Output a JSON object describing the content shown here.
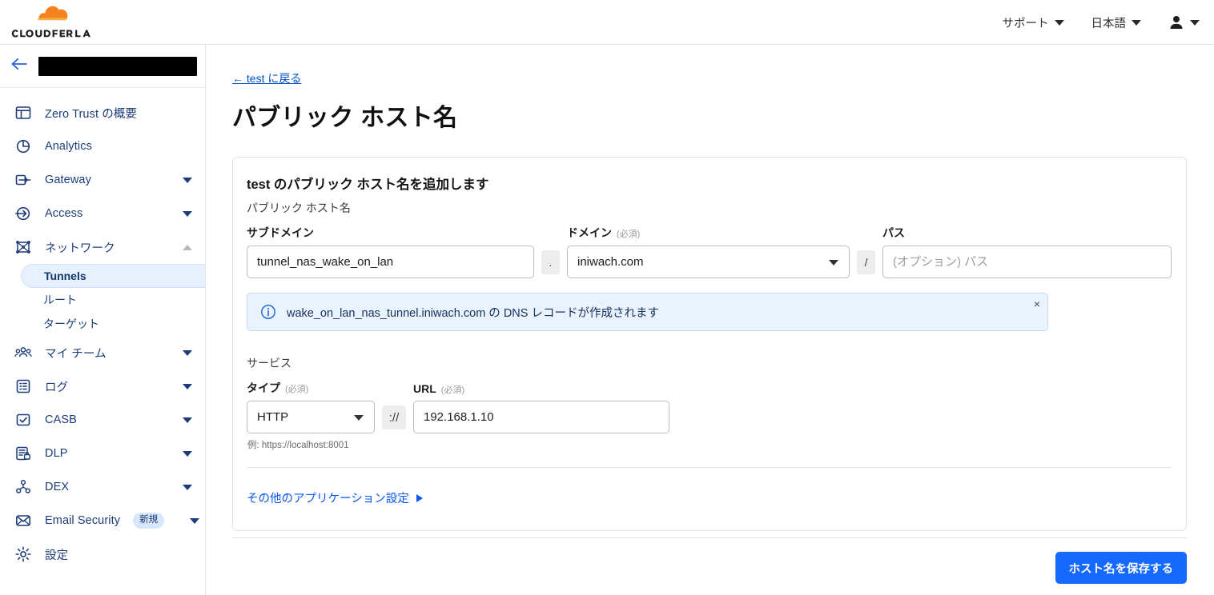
{
  "topbar": {
    "logo_alt": "Cloudflare",
    "support_label": "サポート",
    "language_label": "日本語"
  },
  "sidebar": {
    "account_name": "",
    "items": [
      {
        "label": "Zero Trust の概要",
        "icon": "overview-icon",
        "expandable": false
      },
      {
        "label": "Analytics",
        "icon": "analytics-icon",
        "expandable": false
      },
      {
        "label": "Gateway",
        "icon": "gateway-icon",
        "expandable": true
      },
      {
        "label": "Access",
        "icon": "access-icon",
        "expandable": true
      },
      {
        "label": "ネットワーク",
        "icon": "network-icon",
        "expandable": true,
        "expanded": true
      },
      {
        "label": "マイ チーム",
        "icon": "team-icon",
        "expandable": true
      },
      {
        "label": "ログ",
        "icon": "logs-icon",
        "expandable": true
      },
      {
        "label": "CASB",
        "icon": "casb-icon",
        "expandable": true
      },
      {
        "label": "DLP",
        "icon": "dlp-icon",
        "expandable": true
      },
      {
        "label": "DEX",
        "icon": "dex-icon",
        "expandable": true
      },
      {
        "label": "Email Security",
        "icon": "email-security-icon",
        "expandable": true,
        "badge": "新規"
      },
      {
        "label": "設定",
        "icon": "settings-gear-icon",
        "expandable": false
      }
    ],
    "network_children": [
      {
        "label": "Tunnels",
        "active": true
      },
      {
        "label": "ルート",
        "active": false
      },
      {
        "label": "ターゲット",
        "active": false
      }
    ]
  },
  "main": {
    "breadcrumb": "← test に戻る",
    "page_title": "パブリック ホスト名",
    "card_title": "test のパブリック ホスト名を追加します",
    "hostname_section_label": "パブリック ホスト名",
    "subdomain": {
      "label": "サブドメイン",
      "value": "tunnel_nas_wake_on_lan"
    },
    "domain": {
      "label": "ドメイン",
      "required_note": "(必須)",
      "value": "iniwach.com"
    },
    "path": {
      "label": "パス",
      "placeholder": "(オプション) パス",
      "value": ""
    },
    "joiner_dot": ".",
    "joiner_slash": "/",
    "info_banner": {
      "text": "wake_on_lan_nas_tunnel.iniwach.com の DNS レコードが作成されます",
      "close_label": "×"
    },
    "service_section_label": "サービス",
    "type": {
      "label": "タイプ",
      "required_note": "(必須)",
      "value": "HTTP"
    },
    "url": {
      "label": "URL",
      "required_note": "(必須)",
      "value": "192.168.1.10"
    },
    "joiner_protocol": "://",
    "url_hint": "例: https://localhost:8001",
    "advanced_link": "その他のアプリケーション設定",
    "save_button": "ホスト名を保存する"
  },
  "colors": {
    "accent_blue": "#1669ff",
    "link_blue": "#0051c3",
    "nav_blue": "#1d3c78",
    "banner_bg": "#eaf2fd",
    "active_pill": "#e7f0fd"
  }
}
